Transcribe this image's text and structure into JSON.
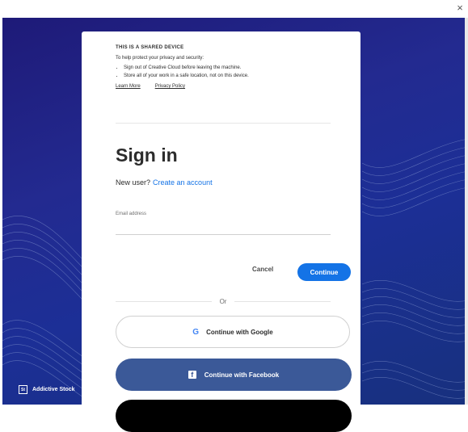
{
  "window": {
    "close_glyph": "×"
  },
  "background": {
    "credit_label": "Addictive Stock",
    "credit_icon": "adobe-stock-icon"
  },
  "notice": {
    "heading": "THIS IS A SHARED DEVICE",
    "intro": "To help protect your privacy and security:",
    "bullets": [
      "Sign out of Creative Cloud before leaving the machine.",
      "Store all of your work in a safe location, not on this device."
    ],
    "learn_more": "Learn More",
    "privacy_policy": "Privacy Policy"
  },
  "signin": {
    "title": "Sign in",
    "new_user_prompt": "New user?",
    "create_account_link": "Create an account",
    "email_label": "Email address",
    "email_value": "",
    "cancel_label": "Cancel",
    "continue_label": "Continue",
    "or_label": "Or",
    "google_label": "Continue with Google",
    "google_icon_glyph": "G",
    "facebook_label": "Continue with Facebook",
    "facebook_icon_glyph": "f"
  },
  "colors": {
    "accent": "#1473e6",
    "facebook": "#3b5998",
    "background": "#1f2a8c"
  }
}
